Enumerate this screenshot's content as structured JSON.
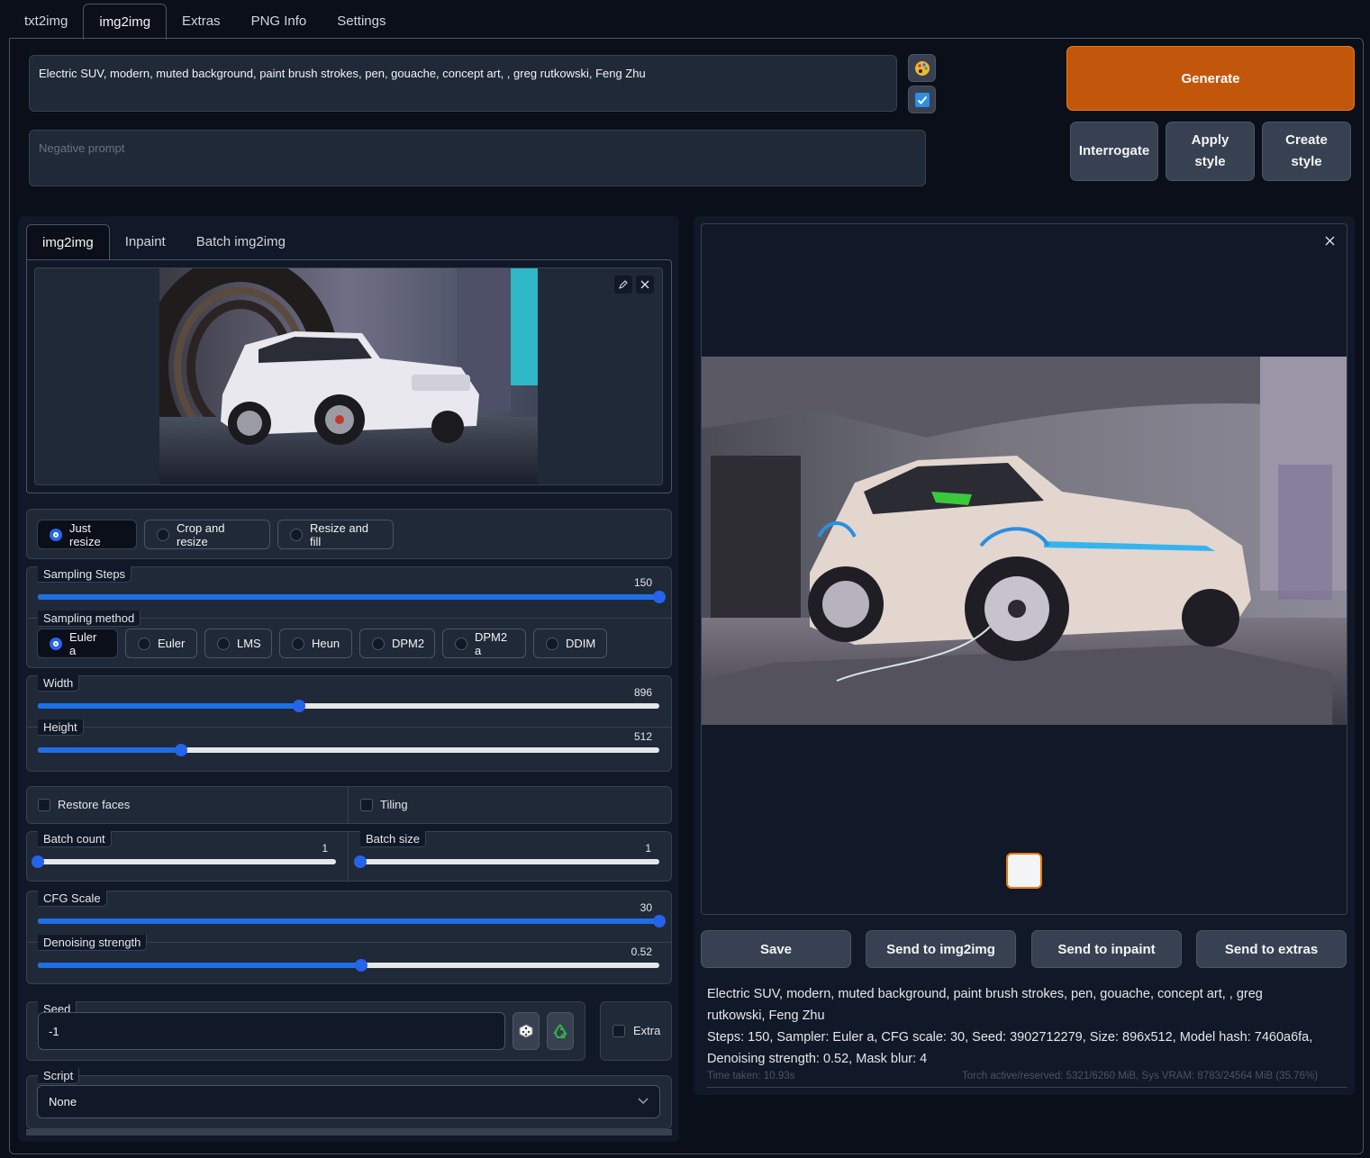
{
  "tabs": [
    "txt2img",
    "img2img",
    "Extras",
    "PNG Info",
    "Settings"
  ],
  "prompt": "Electric SUV, modern, muted background, paint brush strokes, pen, gouache, concept art, , greg rutkowski, Feng Zhu",
  "negative_placeholder": "Negative prompt",
  "buttons": {
    "generate": "Generate",
    "interrogate": "Interrogate",
    "apply_style": "Apply style",
    "create_style": "Create style"
  },
  "sub_tabs": [
    "img2img",
    "Inpaint",
    "Batch img2img"
  ],
  "resize_modes": [
    "Just resize",
    "Crop and resize",
    "Resize and fill"
  ],
  "sampling_steps": {
    "label": "Sampling Steps",
    "value": "150",
    "fraction": 1.0
  },
  "sampling_method": {
    "label": "Sampling method",
    "options": [
      "Euler a",
      "Euler",
      "LMS",
      "Heun",
      "DPM2",
      "DPM2 a",
      "DDIM"
    ],
    "selected": "Euler a"
  },
  "width": {
    "label": "Width",
    "value": "896",
    "fraction": 0.42
  },
  "height": {
    "label": "Height",
    "value": "512",
    "fraction": 0.23
  },
  "restore_faces": "Restore faces",
  "tiling": "Tiling",
  "batch_count": {
    "label": "Batch count",
    "value": "1",
    "fraction": 0.0
  },
  "batch_size": {
    "label": "Batch size",
    "value": "1",
    "fraction": 0.0
  },
  "cfg_scale": {
    "label": "CFG Scale",
    "value": "30",
    "fraction": 1.0
  },
  "denoising": {
    "label": "Denoising strength",
    "value": "0.52",
    "fraction": 0.52
  },
  "seed": {
    "label": "Seed",
    "value": "-1"
  },
  "extra": "Extra",
  "script": {
    "label": "Script",
    "value": "None"
  },
  "output_buttons": {
    "save": "Save",
    "send_img2img": "Send to img2img",
    "send_inpaint": "Send to inpaint",
    "send_extras": "Send to extras"
  },
  "info": {
    "line1": "Electric SUV, modern, muted background, paint brush strokes, pen, gouache, concept art, , greg",
    "line2": "rutkowski, Feng Zhu",
    "line3": "Steps: 150, Sampler: Euler a, CFG scale: 30, Seed: 3902712279, Size: 896x512, Model hash: 7460a6fa,",
    "line4": "Denoising strength: 0.52, Mask blur: 4",
    "time": "Time taken: 10.93s",
    "vram": "Torch active/reserved: 5321/6260 MiB, Sys VRAM: 8783/24564 MiB (35.76%)"
  }
}
